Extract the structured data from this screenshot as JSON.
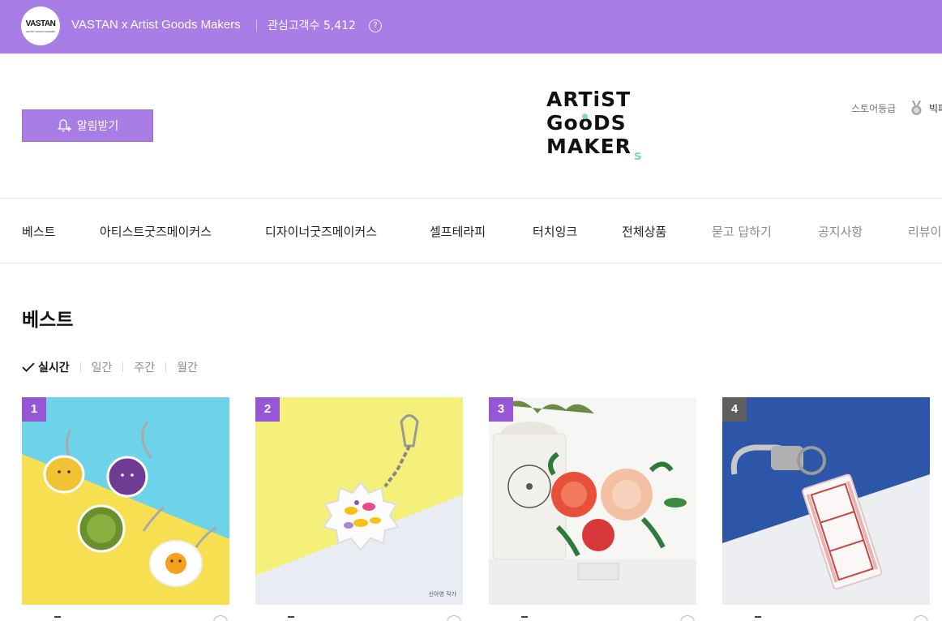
{
  "store": {
    "logo_text": "VASTAN",
    "logo_subtext": "ARTIST GOODS MAKERS",
    "name": "VASTAN x Artist Goods Makers",
    "followers_label": "관심고객수 5,412",
    "help_symbol": "?"
  },
  "header": {
    "notify_label": "알림받기",
    "brand_logo_lines": [
      "ARTiST",
      "GooDS",
      "MAKER"
    ],
    "brand_logo_suffix": "s",
    "grade_label": "스토어등급",
    "grade_name": "빅파워"
  },
  "nav": {
    "items": [
      {
        "label": "베스트"
      },
      {
        "label": "아티스트굿즈메이커스"
      },
      {
        "label": "디자이너굿즈메이커스"
      },
      {
        "label": "셀프테라피"
      },
      {
        "label": "터치잉크"
      },
      {
        "label": "전체상품"
      },
      {
        "label": "묻고 답하기"
      },
      {
        "label": "공지사항"
      },
      {
        "label": "리뷰이벤트"
      }
    ]
  },
  "section": {
    "title": "베스트",
    "filters": [
      "실시간",
      "일간",
      "주간",
      "월간"
    ],
    "active_filter": "실시간"
  },
  "products": [
    {
      "rank": "1",
      "image": "food-character-keychains"
    },
    {
      "rank": "2",
      "image": "flower-keyring",
      "author_tag": "신아영 작가"
    },
    {
      "rank": "3",
      "image": "acrylic-flower-stand"
    },
    {
      "rank": "4",
      "image": "korean-text-keyring"
    }
  ],
  "colors": {
    "accent": "#a97de6",
    "rank_top": "#9756d6",
    "rank_other": "#5f5f5f",
    "mint": "#7fd9c4"
  }
}
